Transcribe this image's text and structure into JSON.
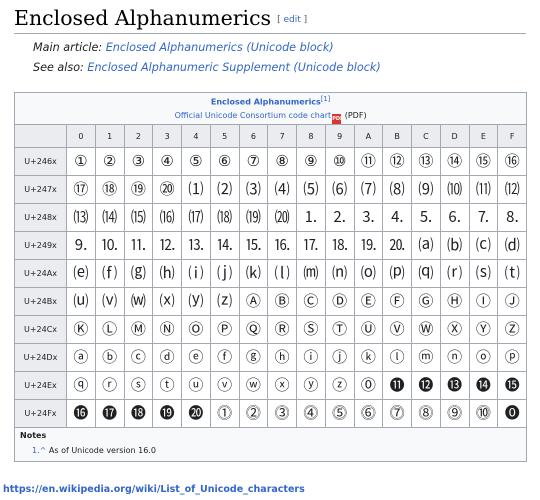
{
  "heading": {
    "title": "Enclosed Alphanumerics",
    "edit_open": "[ ",
    "edit_label": "edit",
    "edit_close": " ]"
  },
  "hatnotes": {
    "main_prefix": "Main article: ",
    "main_link": "Enclosed Alphanumerics (Unicode block)",
    "see_prefix": "See also: ",
    "see_link": "Enclosed Alphanumeric Supplement (Unicode block)"
  },
  "table": {
    "caption_title": "Enclosed Alphanumerics",
    "caption_sup": "[1]",
    "chart_link": "Official Unicode Consortium code chart",
    "pdf_icon": "PDF",
    "chart_suffix": " (PDF)",
    "columns": [
      "0",
      "1",
      "2",
      "3",
      "4",
      "5",
      "6",
      "7",
      "8",
      "9",
      "A",
      "B",
      "C",
      "D",
      "E",
      "F"
    ],
    "rows": [
      {
        "label": "U+246x",
        "cells": [
          "①",
          "②",
          "③",
          "④",
          "⑤",
          "⑥",
          "⑦",
          "⑧",
          "⑨",
          "⑩",
          "⑪",
          "⑫",
          "⑬",
          "⑭",
          "⑮",
          "⑯"
        ]
      },
      {
        "label": "U+247x",
        "cells": [
          "⑰",
          "⑱",
          "⑲",
          "⑳",
          "⑴",
          "⑵",
          "⑶",
          "⑷",
          "⑸",
          "⑹",
          "⑺",
          "⑻",
          "⑼",
          "⑽",
          "⑾",
          "⑿"
        ]
      },
      {
        "label": "U+248x",
        "cells": [
          "⒀",
          "⒁",
          "⒂",
          "⒃",
          "⒄",
          "⒅",
          "⒆",
          "⒇",
          "⒈",
          "⒉",
          "⒊",
          "⒋",
          "⒌",
          "⒍",
          "⒎",
          "⒏"
        ]
      },
      {
        "label": "U+249x",
        "cells": [
          "⒐",
          "⒑",
          "⒒",
          "⒓",
          "⒔",
          "⒕",
          "⒖",
          "⒗",
          "⒘",
          "⒙",
          "⒚",
          "⒛",
          "⒜",
          "⒝",
          "⒞",
          "⒟"
        ]
      },
      {
        "label": "U+24Ax",
        "cells": [
          "⒠",
          "⒡",
          "⒢",
          "⒣",
          "⒤",
          "⒥",
          "⒦",
          "⒧",
          "⒨",
          "⒩",
          "⒪",
          "⒫",
          "⒬",
          "⒭",
          "⒮",
          "⒯"
        ]
      },
      {
        "label": "U+24Bx",
        "cells": [
          "⒰",
          "⒱",
          "⒲",
          "⒳",
          "⒴",
          "⒵",
          "Ⓐ",
          "Ⓑ",
          "Ⓒ",
          "Ⓓ",
          "Ⓔ",
          "Ⓕ",
          "Ⓖ",
          "Ⓗ",
          "Ⓘ",
          "Ⓙ"
        ]
      },
      {
        "label": "U+24Cx",
        "cells": [
          "Ⓚ",
          "Ⓛ",
          "Ⓜ",
          "Ⓝ",
          "Ⓞ",
          "Ⓟ",
          "Ⓠ",
          "Ⓡ",
          "Ⓢ",
          "Ⓣ",
          "Ⓤ",
          "Ⓥ",
          "Ⓦ",
          "Ⓧ",
          "Ⓨ",
          "Ⓩ"
        ]
      },
      {
        "label": "U+24Dx",
        "cells": [
          "ⓐ",
          "ⓑ",
          "ⓒ",
          "ⓓ",
          "ⓔ",
          "ⓕ",
          "ⓖ",
          "ⓗ",
          "ⓘ",
          "ⓙ",
          "ⓚ",
          "ⓛ",
          "ⓜ",
          "ⓝ",
          "ⓞ",
          "ⓟ"
        ]
      },
      {
        "label": "U+24Ex",
        "cells": [
          "ⓠ",
          "ⓡ",
          "ⓢ",
          "ⓣ",
          "ⓤ",
          "ⓥ",
          "ⓦ",
          "ⓧ",
          "ⓨ",
          "ⓩ",
          "⓪",
          "⓫",
          "⓬",
          "⓭",
          "⓮",
          "⓯"
        ]
      },
      {
        "label": "U+24Fx",
        "cells": [
          "⓰",
          "⓱",
          "⓲",
          "⓳",
          "⓴",
          "⓵",
          "⓶",
          "⓷",
          "⓸",
          "⓹",
          "⓺",
          "⓻",
          "⓼",
          "⓽",
          "⓾",
          "⓿"
        ]
      }
    ],
    "notes_heading": "Notes",
    "note_marker": "1.^ ",
    "note_text": "As of Unicode version 16.0"
  },
  "footer_url": "https://en.wikipedia.org/wiki/List_of_Unicode_characters"
}
